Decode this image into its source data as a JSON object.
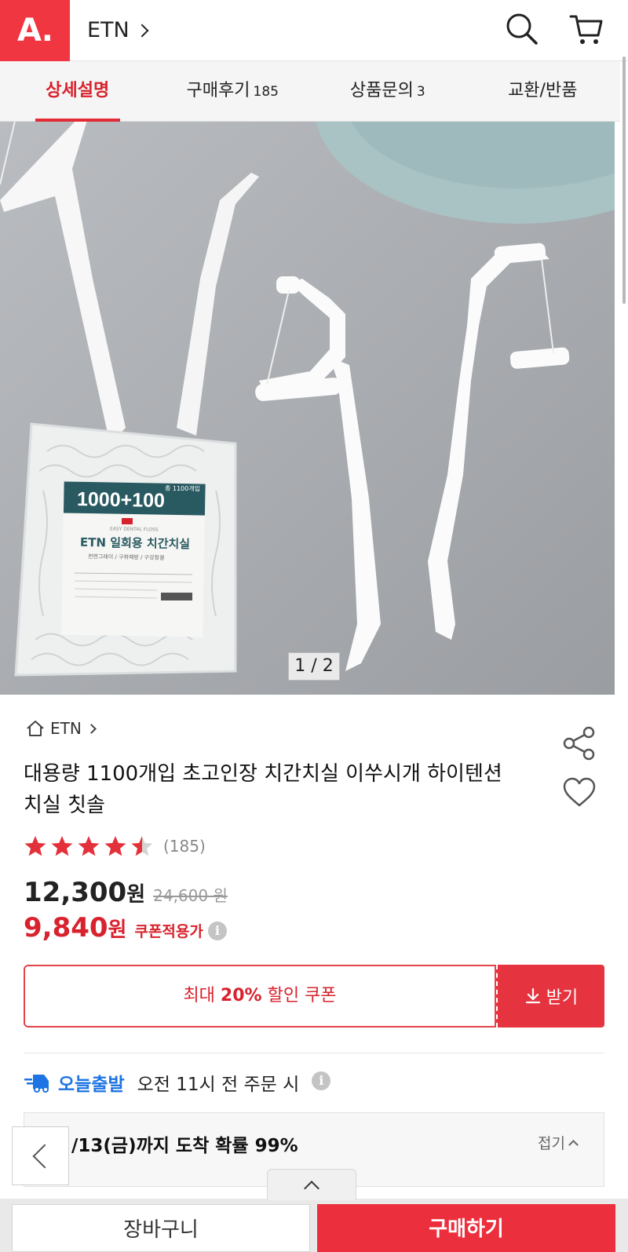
{
  "header": {
    "logo_text": "A.",
    "brand": "ETN"
  },
  "tabs": [
    {
      "label": "상세설명",
      "count": ""
    },
    {
      "label": "구매후기",
      "count": "185"
    },
    {
      "label": "상품문의",
      "count": "3"
    },
    {
      "label": "교환/반품",
      "count": ""
    }
  ],
  "image": {
    "counter": "1 / 2",
    "package_big": "1000+100",
    "package_small": "총 1100개입",
    "package_title": "ETN 일회용 치간치실",
    "package_sub": "EASY DENTAL FLOSS",
    "package_meta": "천연그레이 / 구취예방 / 구강청결"
  },
  "product": {
    "breadcrumb": "ETN",
    "title": "대용량 1100개입 초고인장 치간치실 이쑤시개 하이텐션 치실 칫솔",
    "rating": 4.5,
    "review_count": "(185)",
    "price": "12,300",
    "price_unit": "원",
    "original_price": "24,600 원",
    "coupon_price": "9,840",
    "coupon_unit": "원",
    "coupon_note": "쿠폰적용가",
    "info_mark": "i",
    "accent": "#d8222d"
  },
  "coupon": {
    "prefix": "최대",
    "percent": "20%",
    "suffix": "할인 쿠폰",
    "button": "받기"
  },
  "delivery": {
    "badge": "오늘출발",
    "text": "오전 11시 전 주문 시",
    "arrival": "/13(금)까지 도착 확률 99%",
    "fold": "접기"
  },
  "bottom": {
    "cart": "장바구니",
    "buy": "구매하기"
  }
}
